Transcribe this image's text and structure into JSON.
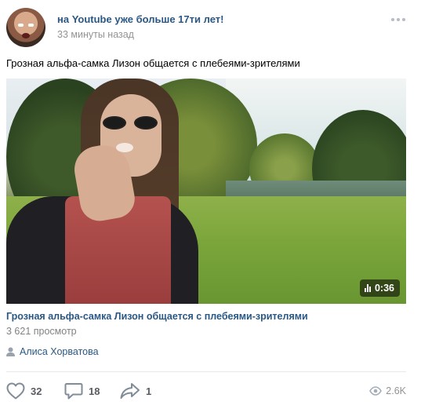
{
  "post": {
    "author": "на Youtube уже больше 17ти лет!",
    "time": "33 минуты назад",
    "text": "Грозная альфа-самка Лизон общается с плебеями-зрителями",
    "more_icon": "more-horizontal-icon"
  },
  "video": {
    "duration": "0:36",
    "title": "Грозная альфа-самка Лизон общается с плебеями-зрителями",
    "views": "3 621 просмотр"
  },
  "signer": {
    "icon": "user-icon",
    "name": "Алиса Хорватова"
  },
  "actions": {
    "likes": "32",
    "comments": "18",
    "shares": "1",
    "views": "2.6K"
  },
  "colors": {
    "link": "#2a5885",
    "secondary": "#939393",
    "icon": "#818c99"
  }
}
